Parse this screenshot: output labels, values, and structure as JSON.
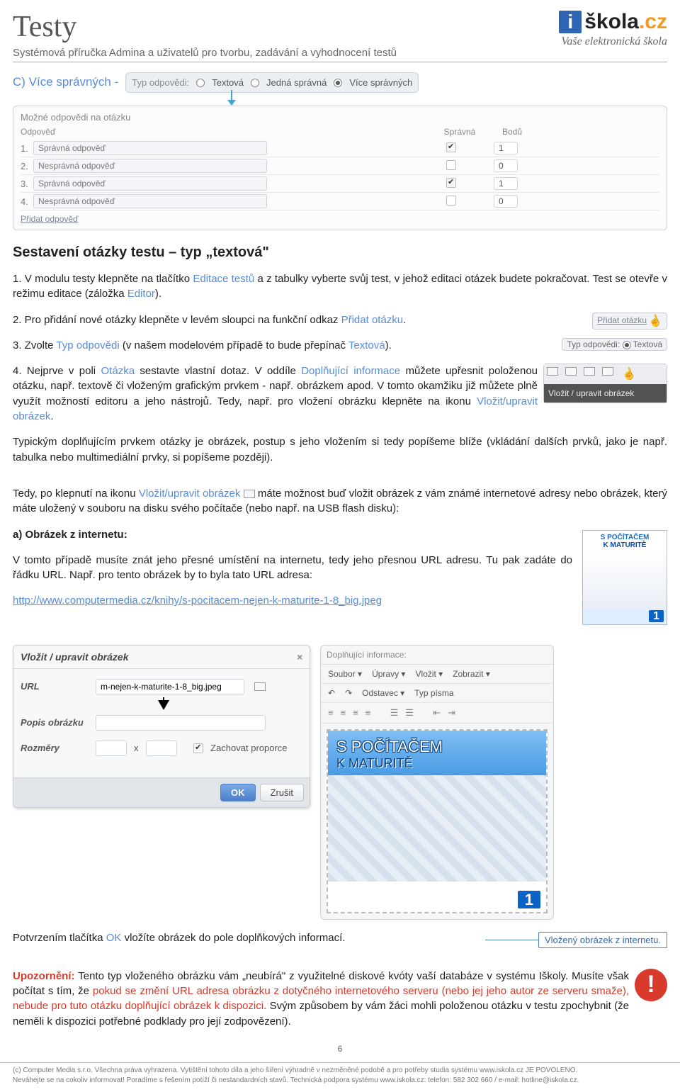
{
  "header": {
    "title": "Testy",
    "subtitle": "Systémová příručka Admina a uživatelů pro tvorbu, zadávání a vyhodnocení testů",
    "logo_i": "i",
    "logo_text_a": "škola",
    "logo_text_b": ".cz",
    "tagline": "Vaše elektronická škola"
  },
  "section_c": {
    "label": "C) Více správných - ",
    "radio_label": "Typ odpovědi:",
    "radio1": "Textová",
    "radio2": "Jedná správná",
    "radio3": "Více správných"
  },
  "answer_table": {
    "title": "Možné odpovědi na otázku",
    "col_a": "Odpověď",
    "col_b": "Správná",
    "col_c": "Bodů",
    "rows": [
      {
        "n": "1.",
        "txt": "Správná odpověď",
        "correct": true,
        "pts": "1"
      },
      {
        "n": "2.",
        "txt": "Nesprávná odpověď",
        "correct": false,
        "pts": "0"
      },
      {
        "n": "3.",
        "txt": "Správná odpověď",
        "correct": true,
        "pts": "1"
      },
      {
        "n": "4.",
        "txt": "Nesprávná odpověď",
        "correct": false,
        "pts": "0"
      }
    ],
    "add_link": "Přidat odpověď"
  },
  "h2": "Sestavení otázky testu – typ „textová\"",
  "para1": {
    "t1": "1. V modulu testy klepněte na tlačítko ",
    "l1": "Editace testů",
    "t2": " a z tabulky vyberte svůj test, v jehož editaci otázek budete pokračovat. Test se otevře v režimu editace (záložka ",
    "l2": "Editor",
    "t3": ")."
  },
  "para2": {
    "t1": "2. Pro přidání nové otázky klepněte v levém sloupci na funkční odkaz ",
    "l1": "Přidat otázku",
    "t2": "."
  },
  "micro_add": {
    "label": "Přidat otázku"
  },
  "para3": {
    "t1": "3. Zvolte ",
    "l1": "Typ odpovědi",
    "t2": " (v našem modelovém případě to bude přepínač ",
    "l2": "Textová",
    "t3": ")."
  },
  "micro_type": {
    "lbl": "Typ odpovědi:",
    "opt": "Textová"
  },
  "para4": {
    "t1": "4. Nejprve v poli ",
    "l1": "Otázka",
    "t2": " sestavte vlastní dotaz. V oddíle ",
    "l2": "Doplňující informace",
    "t3": " můžete upřesnit položenou otázku, např. textově či vloženým grafickým prvkem - např. obrázkem apod. V tomto okamžiku již můžete plně využít možností editoru a jeho nástrojů. Tedy, např. pro vložení obrázku klepněte na ikonu ",
    "l3": "Vložit/upravit obrázek",
    "t4": "."
  },
  "toolbar_tip": "Vložit / upravit obrázek",
  "para5": "Typickým doplňujícím prvkem otázky je obrázek, postup s jeho vložením si tedy popíšeme blíže (vkládání dalších prvků, jako je např. tabulka nebo multimediální prvky, si popíšeme později).",
  "para6": {
    "t1": "Tedy, po klepnutí na ikonu ",
    "l1": "Vložit/upravit obrázek",
    "t2": " máte možnost buď vložit obrázek z vám známé internetové adresy nebo obrázek, který máte uložený v souboru na disku svého počítače (nebo např. na USB flash disku):"
  },
  "para7_a": "a) Obrázek z internetu:",
  "para7_b": "V tomto případě musíte znát jeho přesné umístění na internetu, tedy jeho přesnou URL adresu. Tu pak zadáte do řádku URL. Např. pro tento obrázek by to byla tato URL adresa:",
  "url_link": "http://www.computermedia.cz/knihy/s-pocitacem-nejen-k-maturite-1-8_big.jpeg",
  "book1": {
    "line1": "S POČÍTAČEM",
    "line2": "K MATURITĚ",
    "n": "1"
  },
  "dlg": {
    "title": "Vložit / upravit obrázek",
    "url_lbl": "URL",
    "url_val": "m-nejen-k-maturite-1-8_big.jpeg",
    "desc_lbl": "Popis obrázku",
    "dim_lbl": "Rozměry",
    "x": "x",
    "keep": "Zachovat proporce",
    "ok": "OK",
    "cancel": "Zrušit"
  },
  "editor": {
    "top": "Doplňující informace:",
    "m1": "Soubor ▾",
    "m2": "Úpravy ▾",
    "m3": "Vložit ▾",
    "m4": "Zobrazit ▾",
    "od": "Odstavec ▾",
    "tp": "Typ písma"
  },
  "book2": {
    "line1": "S POČÍTAČEM",
    "line2": "K MATURITĚ",
    "n": "1"
  },
  "after_dlg": {
    "t1": "Potvrzením tlačítka ",
    "l1": "OK",
    "t2": " vložíte obrázek do pole doplňkových informací."
  },
  "callout": "Vložený obrázek z internetu.",
  "warn": {
    "t1": "Upozornění:",
    "t2": " Tento typ vloženého obrázku vám „neubírá\" z využitelné diskové kvóty vaší databáze v systému Iškoly. Musíte však počítat s tím, že ",
    "r1": "pokud se změní URL adresa obrázku z dotyčného internetového serveru (nebo jej jeho autor ze serveru smaže), nebude pro tuto otázku doplňující obrázek k dispozici.",
    "t3": " Svým způsobem by vám žáci mohli položenou otázku v testu zpochybnit (že neměli k dispozici potřebné podklady pro její zodpovězení)."
  },
  "page_number": "6",
  "footer": {
    "l1": "(c) Computer Media s.r.o. Všechna práva vyhrazena. Vytištění tohoto díla a jeho šíření výhradně v nezměněné podobě a pro potřeby studia systému www.iskola.cz JE POVOLENO.",
    "l2": "Neváhejte se na cokoliv informovat! Poradíme s řešením potíží či nestandardních stavů. Technická podpora systému www.iskola.cz: telefon: 582 302 660 / e-mail: hotline@iskola.cz."
  }
}
